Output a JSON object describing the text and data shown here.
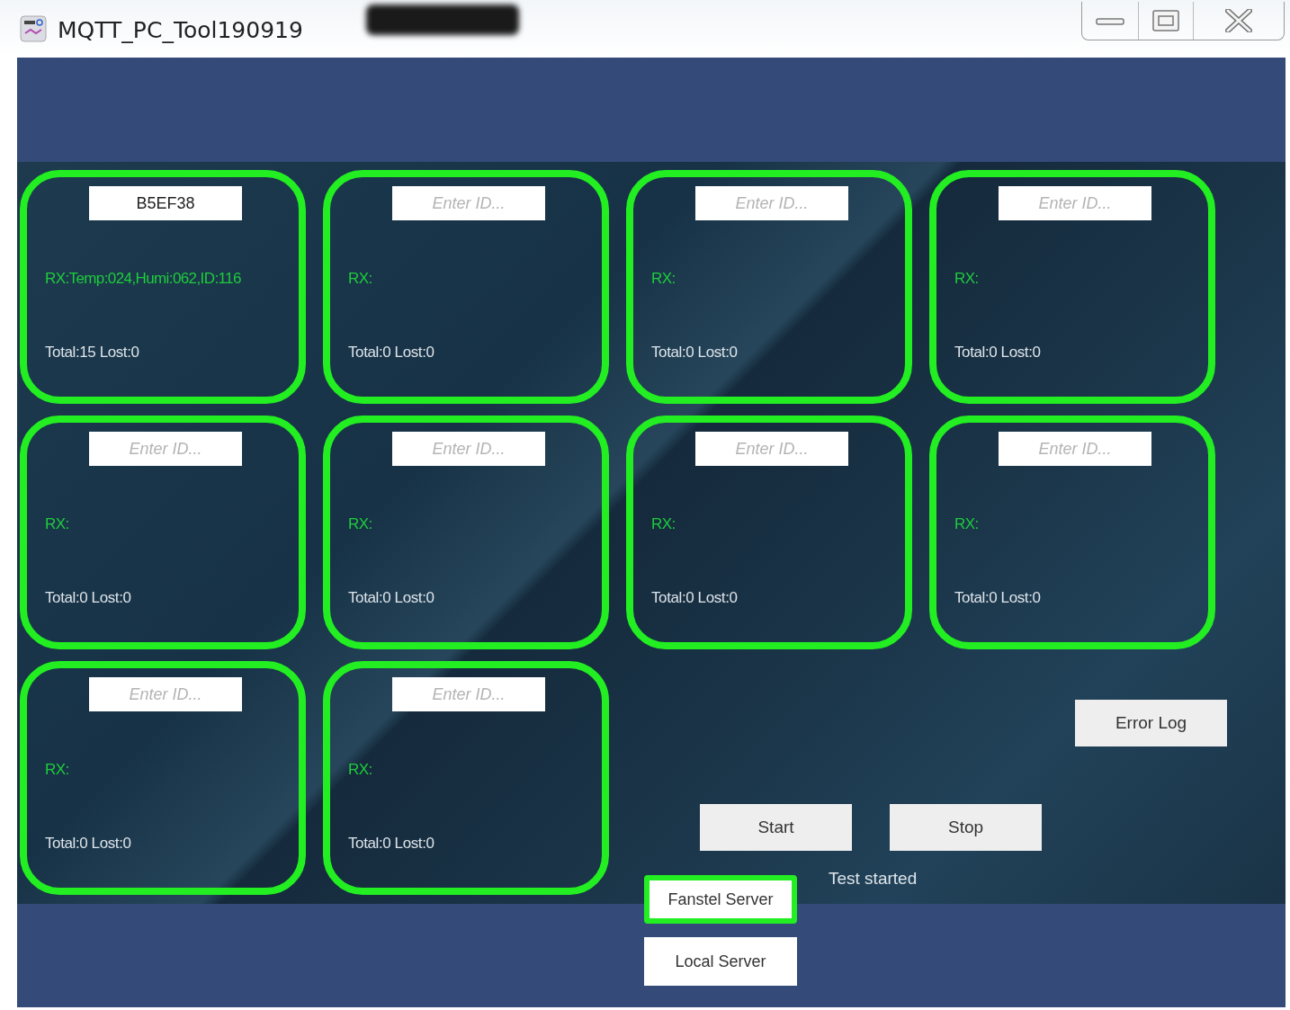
{
  "window": {
    "title": "MQTT_PC_Tool190919"
  },
  "devices": [
    {
      "id": "B5EF38",
      "rx": "RX:Temp:024,Humi:062,ID:116",
      "totals": "Total:15 Lost:0"
    },
    {
      "placeholder": "Enter ID...",
      "rx": "RX:",
      "totals": "Total:0 Lost:0"
    },
    {
      "placeholder": "Enter ID...",
      "rx": "RX:",
      "totals": "Total:0 Lost:0"
    },
    {
      "placeholder": "Enter ID...",
      "rx": "RX:",
      "totals": "Total:0 Lost:0"
    },
    {
      "placeholder": "Enter ID...",
      "rx": "RX:",
      "totals": "Total:0 Lost:0"
    },
    {
      "placeholder": "Enter ID...",
      "rx": "RX:",
      "totals": "Total:0 Lost:0"
    },
    {
      "placeholder": "Enter ID...",
      "rx": "RX:",
      "totals": "Total:0 Lost:0"
    },
    {
      "placeholder": "Enter ID...",
      "rx": "RX:",
      "totals": "Total:0 Lost:0"
    },
    {
      "placeholder": "Enter ID...",
      "rx": "RX:",
      "totals": "Total:0 Lost:0"
    },
    {
      "placeholder": "Enter ID...",
      "rx": "RX:",
      "totals": "Total:0 Lost:0"
    }
  ],
  "error_log_button": "Error Log",
  "start_button": "Start",
  "stop_button": "Stop",
  "status": "Test started",
  "servers": [
    {
      "label": "Fanstel Server",
      "selected": true
    },
    {
      "label": "Local Server",
      "selected": false
    }
  ]
}
